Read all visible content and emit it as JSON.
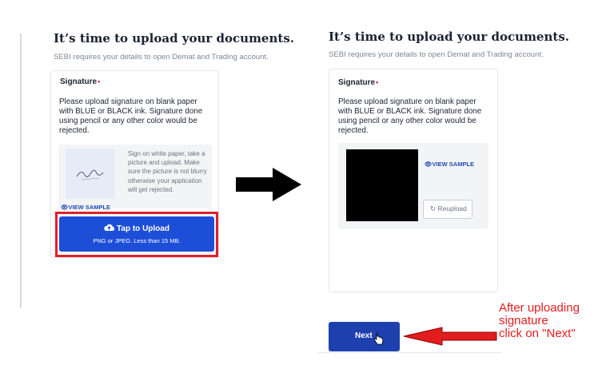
{
  "left_panel": {
    "heading": "It’s time to upload your documents.",
    "subheading": "SEBI requires your details to open Demat and Trading account.",
    "card": {
      "label": "Signature",
      "required_mark": "•",
      "instructions": "Please upload signature on blank paper with BLUE or BLACK ink. Signature done using pencil or any other color would be rejected.",
      "sample_hint": "Sign on white paper, take a picture and upload. Make sure the picture is not blurry otherwise your application will get rejected.",
      "view_sample_label": "VIEW SAMPLE",
      "upload_button": {
        "label": "Tap to Upload",
        "sublabel": "PNG or JPEG. Less than 15 MB."
      }
    }
  },
  "right_panel": {
    "heading": "It’s time to upload your documents.",
    "subheading": "SEBI requires your details to open Demat and Trading account.",
    "card": {
      "label": "Signature",
      "required_mark": "•",
      "instructions": "Please upload signature on blank paper with BLUE or BLACK ink. Signature done using pencil or any other color would be rejected.",
      "view_sample_label": "VIEW SAMPLE",
      "reupload_label": "Reupload"
    },
    "next_button_label": "Next"
  },
  "annotation": {
    "line1": "After uploading",
    "line2": "signature",
    "line3": "click on \"Next\""
  },
  "colors": {
    "primary_blue": "#1d4ed8",
    "highlight_red": "#e0202a",
    "annotation_red": "#e11d1d"
  }
}
